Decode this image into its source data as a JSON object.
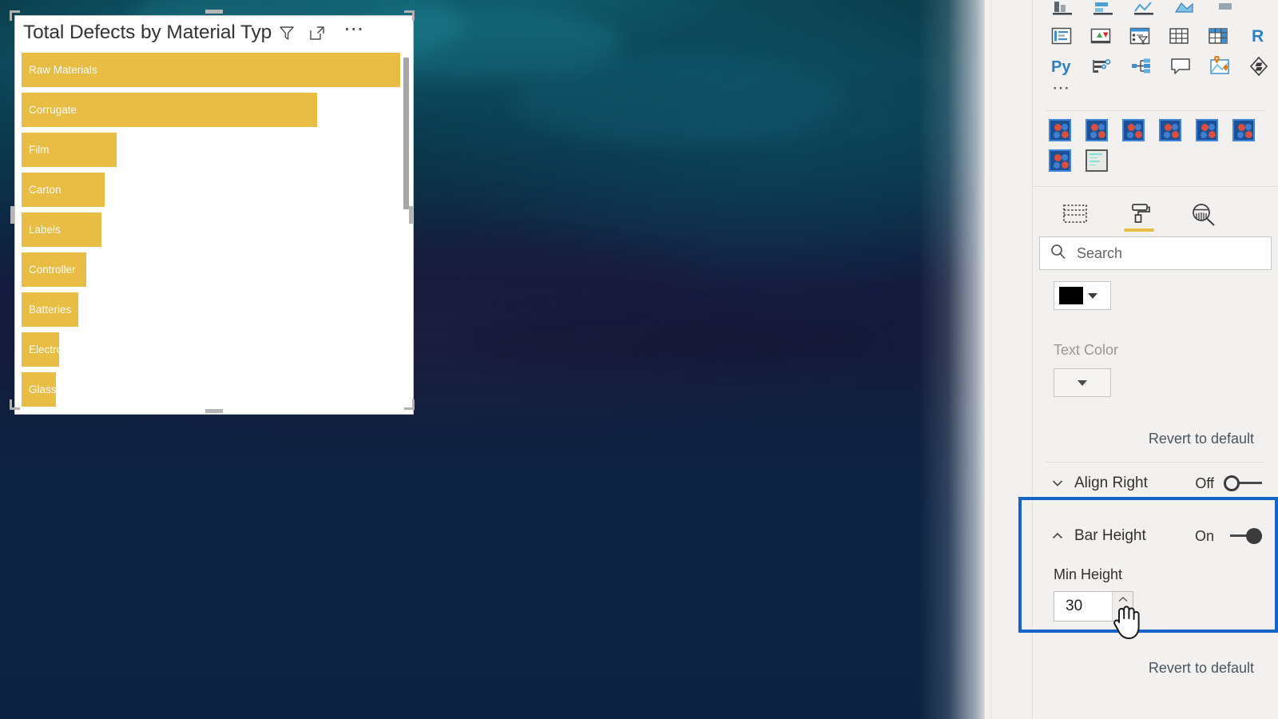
{
  "visual": {
    "title": "Total Defects by Material Typ",
    "header_icons": [
      {
        "name": "filter-icon",
        "label": "Filters"
      },
      {
        "name": "focus-mode-icon",
        "label": "Focus mode"
      },
      {
        "name": "more-options-icon",
        "label": "More options"
      }
    ],
    "more_options_glyph": "⋯"
  },
  "chart_data": {
    "type": "bar",
    "title": "Total Defects by Material Typ",
    "orientation": "horizontal",
    "categories": [
      "Raw Materials",
      "Corrugate",
      "Film",
      "Carton",
      "Labels",
      "Controller",
      "Batteries",
      "Electronics",
      "Glass"
    ],
    "values": [
      100,
      78,
      25,
      22,
      21,
      17,
      15,
      10,
      9
    ],
    "bar_color": "#e8bd44",
    "label_color": "#ffffff",
    "xlabel": "",
    "ylabel": "",
    "grid": false,
    "legend": "none",
    "note": "Bar widths shown as percent of plot width; data labels are category names rendered inside bars and are clipped by bar width."
  },
  "visualizations_pane": {
    "icon_rows": [
      [
        {
          "name": "stacked-column-chart-icon"
        },
        {
          "name": "clustered-bar-chart-icon"
        },
        {
          "name": "line-chart-icon"
        },
        {
          "name": "area-chart-icon"
        },
        {
          "name": "ribbon-chart-icon"
        }
      ],
      [
        {
          "name": "multi-row-card-icon"
        },
        {
          "name": "kpi-icon"
        },
        {
          "name": "slicer-icon"
        },
        {
          "name": "table-icon"
        },
        {
          "name": "matrix-icon"
        },
        {
          "name": "r-script-visual-icon",
          "glyph": "R"
        }
      ],
      [
        {
          "name": "python-visual-icon",
          "glyph": "Py"
        },
        {
          "name": "key-influencers-icon"
        },
        {
          "name": "decomposition-tree-icon"
        },
        {
          "name": "smart-narrative-icon"
        },
        {
          "name": "azure-map-icon"
        },
        {
          "name": "power-apps-icon"
        }
      ]
    ],
    "more_visuals_glyph": "⋯",
    "custom_visuals": {
      "row1_count": 6,
      "row2_count": 1,
      "selected_name": "selected-custom-visual"
    }
  },
  "format_pane": {
    "tabs": [
      {
        "name": "tab-fields",
        "icon": "fields-icon",
        "active": false
      },
      {
        "name": "tab-format",
        "icon": "paint-roller-icon",
        "active": true
      },
      {
        "name": "tab-analytics",
        "icon": "analytics-magnifier-icon",
        "active": false
      }
    ],
    "accent_color": "#e8bd44",
    "search": {
      "placeholder": "Search",
      "value": "Search"
    },
    "partial_color_control": {
      "swatch_color": "#000000",
      "name": "color-dropdown"
    },
    "text_color": {
      "label": "Text Color",
      "swatch_color": "",
      "revert_label": "Revert to default"
    },
    "sections": [
      {
        "name": "align-right",
        "title": "Align Right",
        "expanded": false,
        "toggle_state": "Off",
        "toggle_on": false
      },
      {
        "name": "bar-height",
        "title": "Bar Height",
        "expanded": true,
        "toggle_state": "On",
        "toggle_on": true,
        "highlighted": true,
        "fields": [
          {
            "name": "min-height-stepper",
            "label": "Min Height",
            "value": "30"
          }
        ],
        "revert_label": "Revert to default"
      }
    ]
  }
}
